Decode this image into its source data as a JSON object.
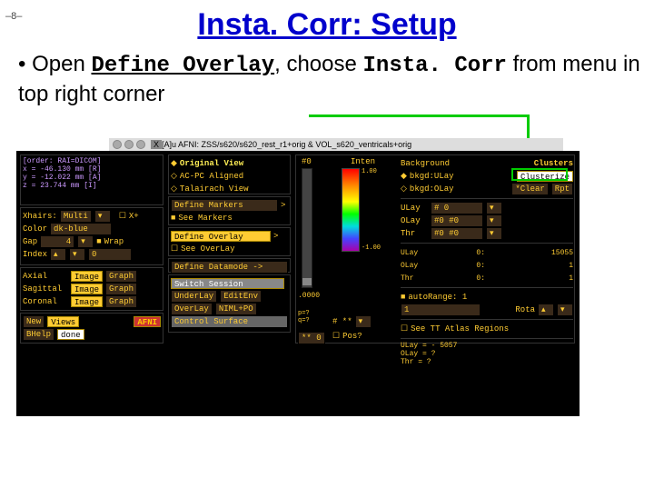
{
  "page_number": "–8–",
  "title": "Insta. Corr: Setup",
  "bullet_prefix": "Open ",
  "bullet_define": "Define Overlay",
  "bullet_mid": ", choose ",
  "bullet_instacorr": "Insta. Corr",
  "bullet_suffix": " from menu in top right corner",
  "window_title_icon": "X",
  "window_title": " [A]u AFNI: ZSS/s620/s620_rest_r1+orig & VOL_s620_ventricals+orig",
  "coords": {
    "order": "[order: RAI=DICOM]",
    "x": "x = -46.130 mm [R]",
    "y": "y = -12.022 mm [A]",
    "z": "z =  23.744 mm [I]"
  },
  "left": {
    "xhairs": "Xhairs:",
    "multi": "Multi",
    "xplus": "X+",
    "color": "Color",
    "dkblue": "dk-blue",
    "gap": "Gap",
    "gapv": "4",
    "wrap": "Wrap",
    "index": "Index",
    "indexv": "0",
    "axial": "Axial",
    "sagittal": "Sagittal",
    "coronal": "Coronal",
    "image": "Image",
    "graph": "Graph",
    "new": "New",
    "views": "Views",
    "bhelp": "BHelp",
    "done": "done",
    "afni": "AFNI"
  },
  "mid": {
    "orig": "Original View",
    "acpc": "AC-PC Aligned",
    "tlrc": "Talairach View",
    "defmark": "Define Markers",
    "seemarkers": "See Markers",
    "defoverlay": "Define Overlay",
    "seeoverlay": "See OverLay",
    "datamode": "Define Datamode ->",
    "switch": "Switch Session",
    "underlay": "UnderLay",
    "editenv": "EditEnv",
    "overlay": "OverLay",
    "nimlpo": "NIML+PO",
    "ctrlsurf": "Control Surface"
  },
  "right": {
    "sharp0": "#0",
    "inten": "Inten",
    "bg": "Background",
    "clusters": "Clusters",
    "bkgd": "bkgd:ULay",
    "clusterize": "Clusterize",
    "bkgd_olay": "bkgd:OLay",
    "clear": "*Clear",
    "rpt": "Rpt",
    "ulay": "ULay",
    "ulay0": "#  0",
    "olay": "OLay",
    "olay0": "#0 #0",
    "thr": "Thr",
    "thr0": "#0 #0",
    "ulay_v": "0:",
    "olay_v": "0:",
    "thr_v": "0:",
    "n15055": "15055",
    "n1a": "1",
    "n1b": "1",
    "autorange": "autoRange: 1",
    "rota": "Rota",
    "hash": "# **",
    "pos": "Pos?",
    "ulay_eq": "ULay = -   5057",
    "olay_eq": "OLay = ?",
    "thr_eq": "Thr  = ?",
    "atlas": "See TT Atlas Regions",
    "pf": "p=?\nq=?",
    "z0": "** 0",
    "n10000": ".0000"
  }
}
